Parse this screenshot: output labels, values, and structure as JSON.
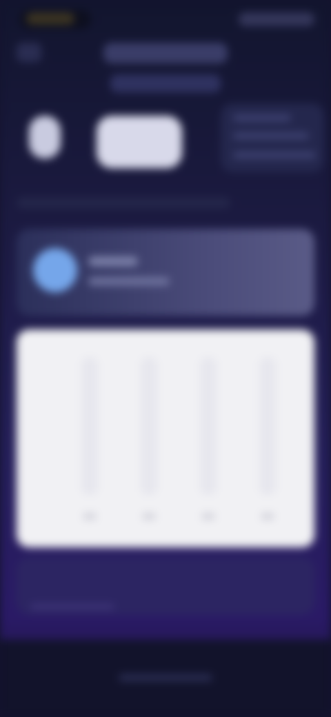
{
  "colors": {
    "background_top": "#12152e",
    "background_bottom": "#2a1a66",
    "card_alert": "#4b4c7a",
    "alert_avatar": "#75a6ea",
    "panel": "#f1f1f4"
  },
  "icons": {
    "weather": "weather-icon",
    "alert": "alert-avatar-icon"
  }
}
